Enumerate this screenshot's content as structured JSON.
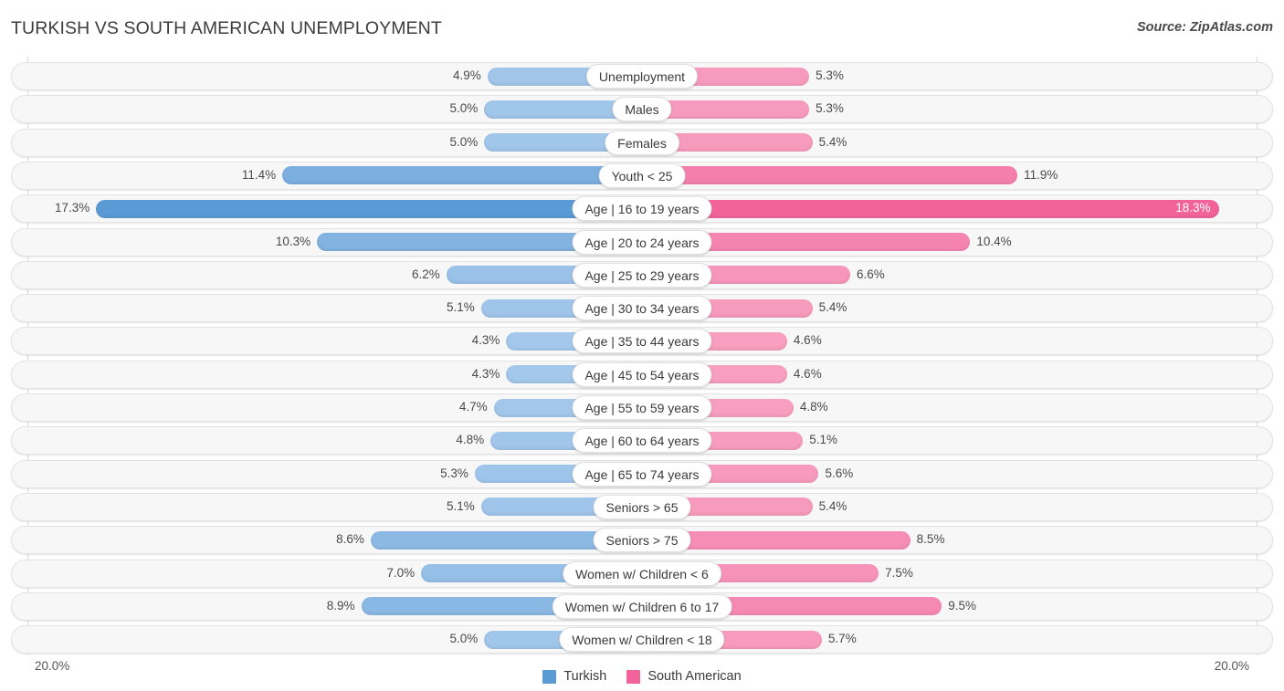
{
  "header": {
    "title": "TURKISH VS SOUTH AMERICAN UNEMPLOYMENT",
    "source": "Source: ZipAtlas.com"
  },
  "footer": {
    "axis_left": "20.0%",
    "axis_right": "20.0%",
    "legend": [
      {
        "label": "Turkish",
        "color": "#5b9bd5"
      },
      {
        "label": "South American",
        "color": "#f2639b"
      }
    ]
  },
  "colors": {
    "left_light": "#a6c9ec",
    "left_dark": "#5b9bd5",
    "right_light": "#f8a1c1",
    "right_dark": "#f2639b",
    "track": "#f7f7f7",
    "track_border": "#e3e3e3"
  },
  "chart_data": {
    "type": "bar",
    "subtype": "diverging-bidirectional",
    "title": "TURKISH VS SOUTH AMERICAN UNEMPLOYMENT",
    "xlabel": "",
    "ylabel": "",
    "axis_max": 20.0,
    "axis_min": 0.0,
    "unit": "%",
    "grid": false,
    "legend_position": "bottom-center",
    "categories": [
      "Unemployment",
      "Males",
      "Females",
      "Youth < 25",
      "Age | 16 to 19 years",
      "Age | 20 to 24 years",
      "Age | 25 to 29 years",
      "Age | 30 to 34 years",
      "Age | 35 to 44 years",
      "Age | 45 to 54 years",
      "Age | 55 to 59 years",
      "Age | 60 to 64 years",
      "Age | 65 to 74 years",
      "Seniors > 65",
      "Seniors > 75",
      "Women w/ Children < 6",
      "Women w/ Children 6 to 17",
      "Women w/ Children < 18"
    ],
    "series": [
      {
        "name": "Turkish",
        "side": "left",
        "values": [
          4.9,
          5.0,
          5.0,
          11.4,
          17.3,
          10.3,
          6.2,
          5.1,
          4.3,
          4.3,
          4.7,
          4.8,
          5.3,
          5.1,
          8.6,
          7.0,
          8.9,
          5.0
        ],
        "labels": [
          "4.9%",
          "5.0%",
          "5.0%",
          "11.4%",
          "17.3%",
          "10.3%",
          "6.2%",
          "5.1%",
          "4.3%",
          "4.3%",
          "4.7%",
          "4.8%",
          "5.3%",
          "5.1%",
          "8.6%",
          "7.0%",
          "8.9%",
          "5.0%"
        ]
      },
      {
        "name": "South American",
        "side": "right",
        "values": [
          5.3,
          5.3,
          5.4,
          11.9,
          18.3,
          10.4,
          6.6,
          5.4,
          4.6,
          4.6,
          4.8,
          5.1,
          5.6,
          5.4,
          8.5,
          7.5,
          9.5,
          5.7
        ],
        "labels": [
          "5.3%",
          "5.3%",
          "5.4%",
          "11.9%",
          "18.3%",
          "10.4%",
          "6.6%",
          "5.4%",
          "4.6%",
          "4.6%",
          "4.8%",
          "5.1%",
          "5.6%",
          "5.4%",
          "8.5%",
          "7.5%",
          "9.5%",
          "5.7%"
        ]
      }
    ]
  }
}
